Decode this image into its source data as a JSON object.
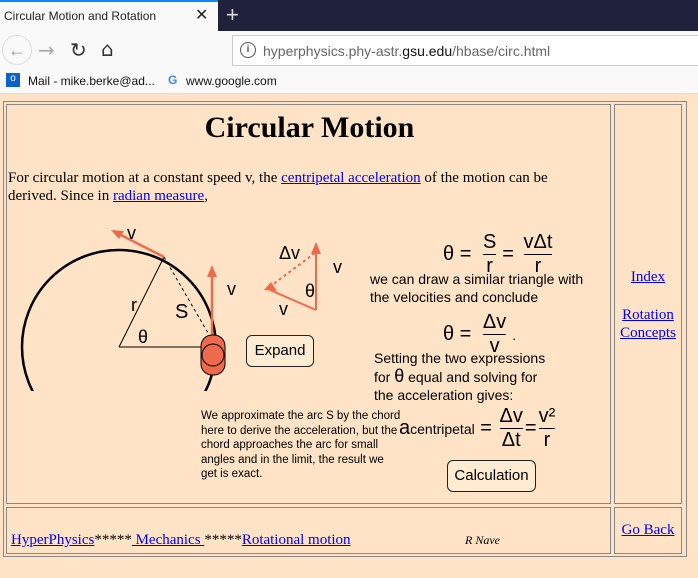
{
  "browser": {
    "tab_title": "Circular Motion and Rotation",
    "url_host": "hyperphysics.phy-astr.",
    "url_domain": "gsu.edu",
    "url_path": "/hbase/circ.html",
    "bookmarks": [
      "Mail - mike.berke@ad...",
      "www.google.com"
    ]
  },
  "page": {
    "title": "Circular Motion",
    "intro_1": "For circular motion at a constant speed v, the ",
    "intro_link1": "centripetal acceleration",
    "intro_2": " of the motion can be derived. Since in ",
    "intro_link2": "radian measure",
    "intro_3": ",",
    "diagram": {
      "v": "v",
      "r": "r",
      "S": "S",
      "theta": "θ",
      "dv": "Δv",
      "expand": "Expand",
      "note": "We approximate the arc S by the chord here to derive the acceleration, but the chord approaches the arc for small angles and in the limit, the result we get is exact."
    },
    "eq1": {
      "lhs": "θ",
      "eq": "=",
      "num": "S",
      "den": "r",
      "num2": "vΔt",
      "den2": "r"
    },
    "text_similar": "we can draw a similar triangle with the velocities and conclude",
    "eq2": {
      "lhs": "θ",
      "num": "Δv",
      "den": "v",
      "dot": "."
    },
    "text_setting_1": "Setting the two expressions",
    "text_setting_2": "for",
    "text_setting_3": "equal and solving for",
    "text_setting_4": "the acceleration gives:",
    "eq3": {
      "a": "a",
      "sub": "centripetal",
      "num": "Δv",
      "den": "Δt",
      "num2": "v²",
      "den2": "r"
    },
    "calc": "Calculation",
    "side": {
      "index": "Index",
      "rotation": "Rotation Concepts"
    },
    "footer": {
      "hp": "HyperPhysics",
      "stars": "*****",
      "mech": " Mechanics ",
      "rot": "Rotational motion",
      "author": "R Nave",
      "goback": "Go Back"
    }
  }
}
